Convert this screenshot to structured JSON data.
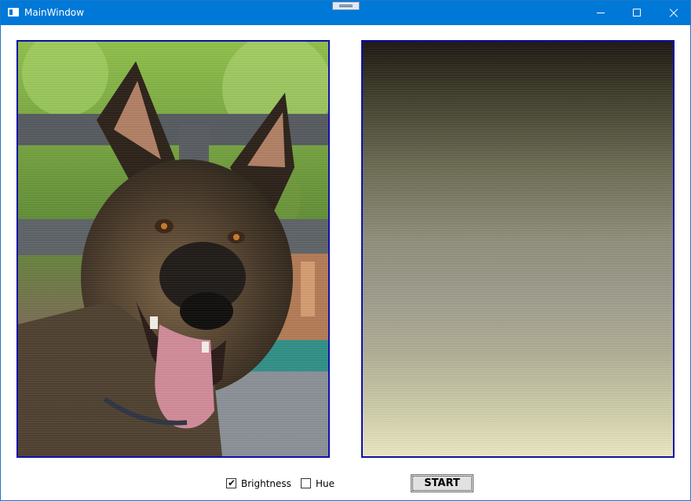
{
  "window": {
    "title": "MainWindow"
  },
  "titlebar_buttons": [
    "minimize-icon",
    "maximize-icon",
    "close-icon"
  ],
  "images": {
    "source": "photo of a Belgian Malinois dog with its tongue out in front of a wooden fence",
    "result": "processed image: noisy vertical gradient from dark brown at top to pale yellow-beige at bottom"
  },
  "controls": {
    "brightness": {
      "label": "Brightness",
      "checked": true
    },
    "hue": {
      "label": "Hue",
      "checked": false
    },
    "start_label": "START"
  },
  "colors": {
    "titlebar": "#0078d7",
    "panel_border": "#0d0fa6",
    "button_face": "#e1e1e1"
  }
}
